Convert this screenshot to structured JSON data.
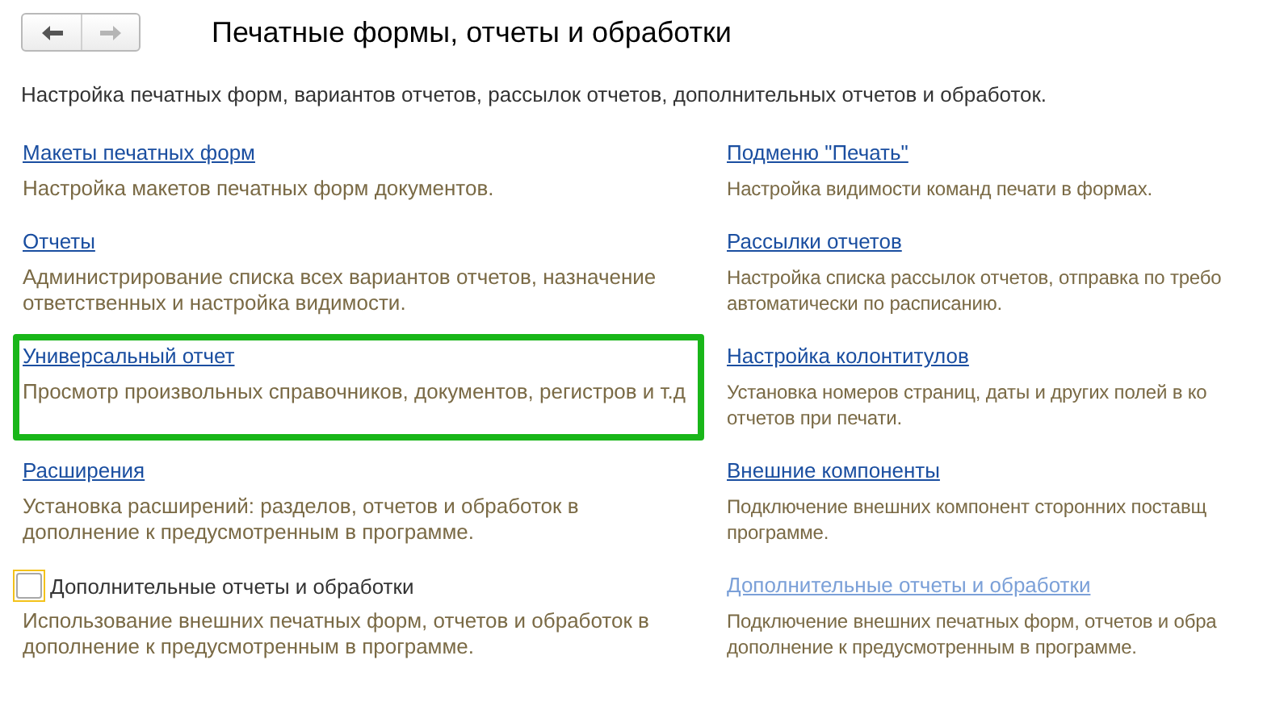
{
  "title": "Печатные формы, отчеты и обработки",
  "subtitle": "Настройка печатных форм, вариантов отчетов, рассылок отчетов, дополнительных отчетов и обработок.",
  "rows": [
    [
      {
        "kind": "link",
        "label": "Макеты печатных форм",
        "disabled": false,
        "highlighted": false,
        "description": [
          "Настройка макетов печатных форм документов."
        ]
      },
      {
        "kind": "link",
        "label": "Подменю \"Печать\"",
        "disabled": false,
        "highlighted": false,
        "description": [
          "Настройка видимости команд печати в формах."
        ]
      }
    ],
    [
      {
        "kind": "link",
        "label": "Отчеты",
        "disabled": false,
        "highlighted": false,
        "description": [
          "Администрирование списка всех вариантов отчетов, назначение",
          "ответственных и настройка видимости."
        ]
      },
      {
        "kind": "link",
        "label": "Рассылки отчетов",
        "disabled": false,
        "highlighted": false,
        "description": [
          "Настройка списка рассылок отчетов, отправка по требо",
          "автоматически по расписанию."
        ]
      }
    ],
    [
      {
        "kind": "link",
        "label": "Универсальный отчет",
        "disabled": false,
        "highlighted": true,
        "description": [
          "Просмотр произвольных справочников, документов, регистров и т.д"
        ]
      },
      {
        "kind": "link",
        "label": "Настройка колонтитулов",
        "disabled": false,
        "highlighted": false,
        "description": [
          "Установка номеров страниц, даты и других полей в ко",
          "отчетов при печати."
        ]
      }
    ],
    [
      {
        "kind": "link",
        "label": "Расширения",
        "disabled": false,
        "highlighted": false,
        "description": [
          "Установка расширений: разделов, отчетов и обработок в",
          "дополнение к предусмотренным в программе."
        ]
      },
      {
        "kind": "link",
        "label": "Внешние компоненты",
        "disabled": false,
        "highlighted": false,
        "description": [
          "Подключение внешних компонент сторонних поставщ",
          "программе."
        ]
      }
    ],
    [
      {
        "kind": "checkbox",
        "label": "Дополнительные отчеты и обработки",
        "checked": false,
        "focused": true,
        "description": [
          "Использование внешних печатных форм, отчетов и обработок в",
          "дополнение к предусмотренным в программе."
        ]
      },
      {
        "kind": "link",
        "label": "Дополнительные отчеты и обработки",
        "disabled": true,
        "highlighted": false,
        "description": [
          "Подключение внешних печатных форм, отчетов и обра",
          "дополнение к предусмотренным в программе."
        ]
      }
    ]
  ]
}
